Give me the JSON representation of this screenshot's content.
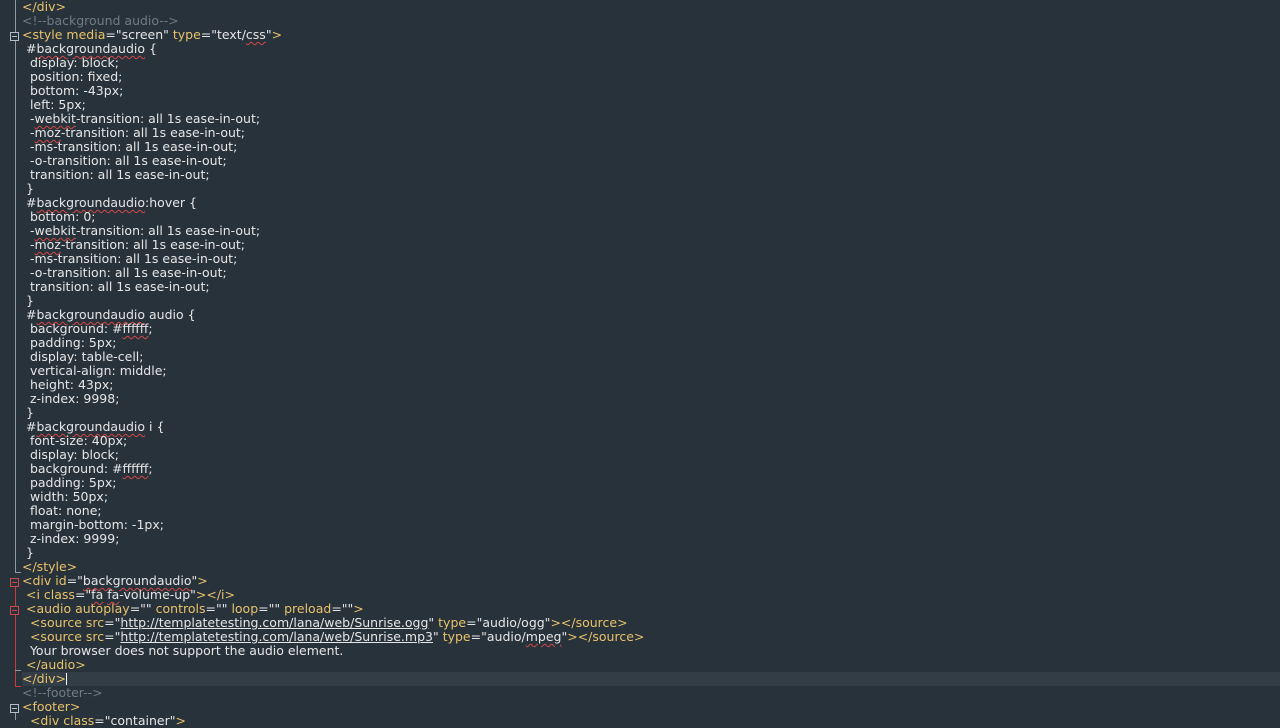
{
  "editor": {
    "lines": [
      [
        {
          "c": "tag",
          "t": "</div>"
        }
      ],
      [
        {
          "c": "comment",
          "t": "<!--background audio-->"
        }
      ],
      [
        {
          "c": "tag",
          "t": "<style "
        },
        {
          "c": "attr",
          "t": "media"
        },
        {
          "c": "text",
          "t": "=\"screen\" "
        },
        {
          "c": "attr",
          "t": "type"
        },
        {
          "c": "text",
          "t": "=\"text/"
        },
        {
          "c": "squiggle",
          "t": "css"
        },
        {
          "c": "text",
          "t": "\""
        },
        {
          "c": "tag",
          "t": ">"
        }
      ],
      [
        {
          "c": "text",
          "t": " #"
        },
        {
          "c": "squiggle",
          "t": "backgroundaudio"
        },
        {
          "c": "text",
          "t": " {"
        }
      ],
      [
        {
          "c": "text",
          "t": "  display: block;"
        }
      ],
      [
        {
          "c": "text",
          "t": "  position: fixed;"
        }
      ],
      [
        {
          "c": "text",
          "t": "  bottom: -43px;"
        }
      ],
      [
        {
          "c": "text",
          "t": "  left: 5px;"
        }
      ],
      [
        {
          "c": "text",
          "t": "  -"
        },
        {
          "c": "squiggle",
          "t": "webkit"
        },
        {
          "c": "text",
          "t": "-transition: all 1s ease-in-out;"
        }
      ],
      [
        {
          "c": "text",
          "t": "  -"
        },
        {
          "c": "squiggle",
          "t": "moz"
        },
        {
          "c": "text",
          "t": "-transition: all 1s ease-in-out;"
        }
      ],
      [
        {
          "c": "text",
          "t": "  -ms-transition: all 1s ease-in-out;"
        }
      ],
      [
        {
          "c": "text",
          "t": "  -o-transition: all 1s ease-in-out;"
        }
      ],
      [
        {
          "c": "text",
          "t": "  transition: all 1s ease-in-out;"
        }
      ],
      [
        {
          "c": "text",
          "t": " }"
        }
      ],
      [
        {
          "c": "text",
          "t": " #"
        },
        {
          "c": "squiggle",
          "t": "backgroundaudio"
        },
        {
          "c": "text",
          "t": ":hover {"
        }
      ],
      [
        {
          "c": "text",
          "t": "  bottom: 0;"
        }
      ],
      [
        {
          "c": "text",
          "t": "  -"
        },
        {
          "c": "squiggle",
          "t": "webkit"
        },
        {
          "c": "text",
          "t": "-transition: all 1s ease-in-out;"
        }
      ],
      [
        {
          "c": "text",
          "t": "  -"
        },
        {
          "c": "squiggle",
          "t": "moz"
        },
        {
          "c": "text",
          "t": "-transition: all 1s ease-in-out;"
        }
      ],
      [
        {
          "c": "text",
          "t": "  -ms-transition: all 1s ease-in-out;"
        }
      ],
      [
        {
          "c": "text",
          "t": "  -o-transition: all 1s ease-in-out;"
        }
      ],
      [
        {
          "c": "text",
          "t": "  transition: all 1s ease-in-out;"
        }
      ],
      [
        {
          "c": "text",
          "t": " }"
        }
      ],
      [
        {
          "c": "text",
          "t": " #"
        },
        {
          "c": "squiggle",
          "t": "backgroundaudio"
        },
        {
          "c": "text",
          "t": " audio {"
        }
      ],
      [
        {
          "c": "text",
          "t": "  background: #"
        },
        {
          "c": "squiggle",
          "t": "ffffff"
        },
        {
          "c": "text",
          "t": ";"
        }
      ],
      [
        {
          "c": "text",
          "t": "  padding: 5px;"
        }
      ],
      [
        {
          "c": "text",
          "t": "  display: table-cell;"
        }
      ],
      [
        {
          "c": "text",
          "t": "  vertical-align: middle;"
        }
      ],
      [
        {
          "c": "text",
          "t": "  height: 43px;"
        }
      ],
      [
        {
          "c": "text",
          "t": "  z-index: 9998;"
        }
      ],
      [
        {
          "c": "text",
          "t": " }"
        }
      ],
      [
        {
          "c": "text",
          "t": " #"
        },
        {
          "c": "squiggle",
          "t": "backgroundaudio"
        },
        {
          "c": "text",
          "t": " i {"
        }
      ],
      [
        {
          "c": "text",
          "t": "  font-size: 40px;"
        }
      ],
      [
        {
          "c": "text",
          "t": "  display: block;"
        }
      ],
      [
        {
          "c": "text",
          "t": "  background: #"
        },
        {
          "c": "squiggle",
          "t": "ffffff"
        },
        {
          "c": "text",
          "t": ";"
        }
      ],
      [
        {
          "c": "text",
          "t": "  padding: 5px;"
        }
      ],
      [
        {
          "c": "text",
          "t": "  width: 50px;"
        }
      ],
      [
        {
          "c": "text",
          "t": "  float: none;"
        }
      ],
      [
        {
          "c": "text",
          "t": "  margin-bottom: -1px;"
        }
      ],
      [
        {
          "c": "text",
          "t": "  z-index: 9999;"
        }
      ],
      [
        {
          "c": "text",
          "t": " }"
        }
      ],
      [
        {
          "c": "tag",
          "t": "</style>"
        }
      ],
      [
        {
          "c": "tag",
          "t": "<div "
        },
        {
          "c": "attr",
          "t": "id"
        },
        {
          "c": "text",
          "t": "=\""
        },
        {
          "c": "squiggle",
          "t": "backgroundaudio"
        },
        {
          "c": "text",
          "t": "\""
        },
        {
          "c": "tag",
          "t": ">"
        }
      ],
      [
        {
          "c": "text",
          "t": " "
        },
        {
          "c": "tag",
          "t": "<i "
        },
        {
          "c": "attr",
          "t": "class"
        },
        {
          "c": "text",
          "t": "=\""
        },
        {
          "c": "squiggle",
          "t": "fa"
        },
        {
          "c": "text",
          "t": " "
        },
        {
          "c": "squiggle",
          "t": "fa"
        },
        {
          "c": "text",
          "t": "-volume-up\""
        },
        {
          "c": "tag",
          "t": "></i>"
        }
      ],
      [
        {
          "c": "text",
          "t": " "
        },
        {
          "c": "tag",
          "t": "<audio "
        },
        {
          "c": "attr",
          "t": "autoplay"
        },
        {
          "c": "text",
          "t": "=\"\" "
        },
        {
          "c": "attr",
          "t": "controls"
        },
        {
          "c": "text",
          "t": "=\"\" "
        },
        {
          "c": "attr",
          "t": "loop"
        },
        {
          "c": "text",
          "t": "=\"\" "
        },
        {
          "c": "attr",
          "t": "preload"
        },
        {
          "c": "text",
          "t": "=\"\""
        },
        {
          "c": "tag",
          "t": ">"
        }
      ],
      [
        {
          "c": "text",
          "t": "  "
        },
        {
          "c": "tag",
          "t": "<source "
        },
        {
          "c": "attr",
          "t": "src"
        },
        {
          "c": "text",
          "t": "=\""
        },
        {
          "c": "url",
          "t": "http://templatetesting.com/lana/web/Sunrise.ogg"
        },
        {
          "c": "text",
          "t": "\" "
        },
        {
          "c": "attr",
          "t": "type"
        },
        {
          "c": "text",
          "t": "=\"audio/ogg\""
        },
        {
          "c": "tag",
          "t": "></source>"
        }
      ],
      [
        {
          "c": "text",
          "t": "  "
        },
        {
          "c": "tag",
          "t": "<source "
        },
        {
          "c": "attr",
          "t": "src"
        },
        {
          "c": "text",
          "t": "=\""
        },
        {
          "c": "url",
          "t": "http://templatetesting.com/lana/web/Sunrise.mp3"
        },
        {
          "c": "text",
          "t": "\" "
        },
        {
          "c": "attr",
          "t": "type"
        },
        {
          "c": "text",
          "t": "=\"audio/"
        },
        {
          "c": "squiggle",
          "t": "mpeg"
        },
        {
          "c": "text",
          "t": "\""
        },
        {
          "c": "tag",
          "t": "></source>"
        }
      ],
      [
        {
          "c": "text",
          "t": "  Your browser does not support the audio element."
        }
      ],
      [
        {
          "c": "text",
          "t": " "
        },
        {
          "c": "tag",
          "t": "</audio>"
        }
      ],
      [
        {
          "c": "tag",
          "t": "</div>"
        },
        {
          "c": "caret",
          "t": ""
        }
      ],
      [
        {
          "c": "comment",
          "t": "<!--footer-->"
        }
      ],
      [
        {
          "c": "tag",
          "t": "<footer>"
        }
      ],
      [
        {
          "c": "text",
          "t": "  "
        },
        {
          "c": "tag",
          "t": "<div "
        },
        {
          "c": "attr",
          "t": "class"
        },
        {
          "c": "text",
          "t": "=\"container\""
        },
        {
          "c": "tag",
          "t": ">"
        }
      ]
    ]
  }
}
